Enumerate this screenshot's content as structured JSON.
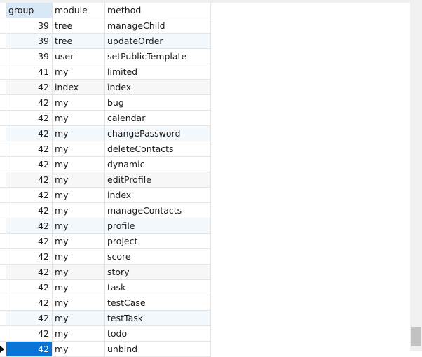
{
  "columns": [
    "group",
    "module",
    "method"
  ],
  "rows": [
    {
      "group": "39",
      "module": "tree",
      "method": "manageChild"
    },
    {
      "group": "39",
      "module": "tree",
      "method": "updateOrder"
    },
    {
      "group": "39",
      "module": "user",
      "method": "setPublicTemplate"
    },
    {
      "group": "41",
      "module": "my",
      "method": "limited"
    },
    {
      "group": "42",
      "module": "index",
      "method": "index"
    },
    {
      "group": "42",
      "module": "my",
      "method": "bug"
    },
    {
      "group": "42",
      "module": "my",
      "method": "calendar"
    },
    {
      "group": "42",
      "module": "my",
      "method": "changePassword"
    },
    {
      "group": "42",
      "module": "my",
      "method": "deleteContacts"
    },
    {
      "group": "42",
      "module": "my",
      "method": "dynamic"
    },
    {
      "group": "42",
      "module": "my",
      "method": "editProfile"
    },
    {
      "group": "42",
      "module": "my",
      "method": "index"
    },
    {
      "group": "42",
      "module": "my",
      "method": "manageContacts"
    },
    {
      "group": "42",
      "module": "my",
      "method": "profile"
    },
    {
      "group": "42",
      "module": "my",
      "method": "project"
    },
    {
      "group": "42",
      "module": "my",
      "method": "score"
    },
    {
      "group": "42",
      "module": "my",
      "method": "story"
    },
    {
      "group": "42",
      "module": "my",
      "method": "task"
    },
    {
      "group": "42",
      "module": "my",
      "method": "testCase"
    },
    {
      "group": "42",
      "module": "my",
      "method": "testTask"
    },
    {
      "group": "42",
      "module": "my",
      "method": "todo"
    },
    {
      "group": "42",
      "module": "my",
      "method": "unbind"
    }
  ],
  "selected_row": 21,
  "colors": {
    "selection": "#0a74d6",
    "header_active": "#d9e8f6"
  }
}
